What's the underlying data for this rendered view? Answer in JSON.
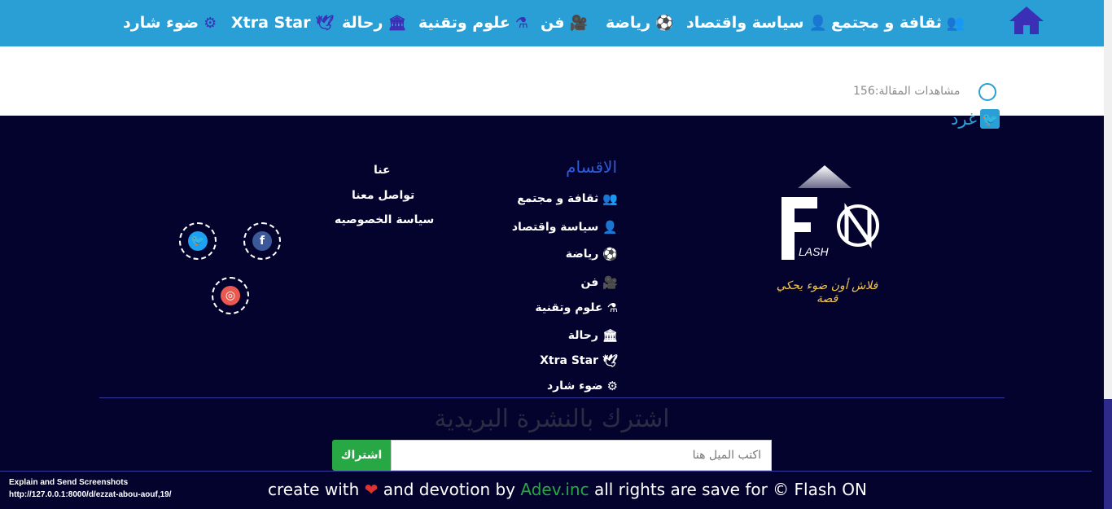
{
  "nav": {
    "home_icon": "home-icon",
    "items": [
      {
        "label": "ثقافة و مجتمع",
        "icon": "👥"
      },
      {
        "label": "سياسة واقتصاد",
        "icon": "👤"
      },
      {
        "label": "رياضة",
        "icon": "⚽"
      },
      {
        "label": "فن",
        "icon": "🎥"
      },
      {
        "label": "علوم وتقنية",
        "icon": "⚗"
      },
      {
        "label": "رحالة",
        "icon": "🏛"
      },
      {
        "label": "Xtra Star",
        "icon": "🕊"
      },
      {
        "label": "ضوء شارد",
        "icon": "⚙"
      }
    ]
  },
  "article": {
    "views_text": "مشاهدات المقالة:156",
    "tweet_label": "غرد"
  },
  "logo": {
    "letters": "FN",
    "sub": "LASH",
    "tagline": "فلاش أون ضوء يحكي قصة"
  },
  "categories": {
    "heading": "الاقسام",
    "items": [
      {
        "label": "ثقافة و مجتمع",
        "icon": "👥"
      },
      {
        "label": "سياسة واقتصاد",
        "icon": "👤"
      },
      {
        "label": "رياضة",
        "icon": "⚽"
      },
      {
        "label": "فن",
        "icon": "🎥"
      },
      {
        "label": "علوم وتقنية",
        "icon": "⚗"
      },
      {
        "label": "رحالة",
        "icon": "🏛"
      },
      {
        "label": "Xtra Star",
        "icon": "🕊"
      },
      {
        "label": "ضوء شارد",
        "icon": "⚙"
      }
    ]
  },
  "about": {
    "items": [
      "عنا",
      "تواصل معنا",
      "سياسة الخصوصيه"
    ]
  },
  "social": {
    "twitter": "twitter-icon",
    "facebook": "facebook-icon",
    "instagram": "instagram-icon",
    "colors": {
      "twitter": "#1da1f2",
      "facebook": "#3b5998",
      "instagram": "#e95950"
    }
  },
  "newsletter": {
    "title": "اشترك بالنشرة البريدية",
    "placeholder": "اكتب الميل هنا",
    "button": "اشتراك"
  },
  "footer": {
    "prefix": "create with",
    "middle": "and devotion by",
    "brand": "Adev.inc",
    "suffix": "all rights are save for © Flash ON"
  },
  "debug": {
    "line1": "Explain and Send Screenshots",
    "line2": "http://127.0.0.1:8000/d/ezzat-abou-aouf,19/"
  },
  "colors": {
    "nav_bg": "#2a9fd6",
    "footer_bg": "#04032e",
    "accent": "#28a745"
  }
}
